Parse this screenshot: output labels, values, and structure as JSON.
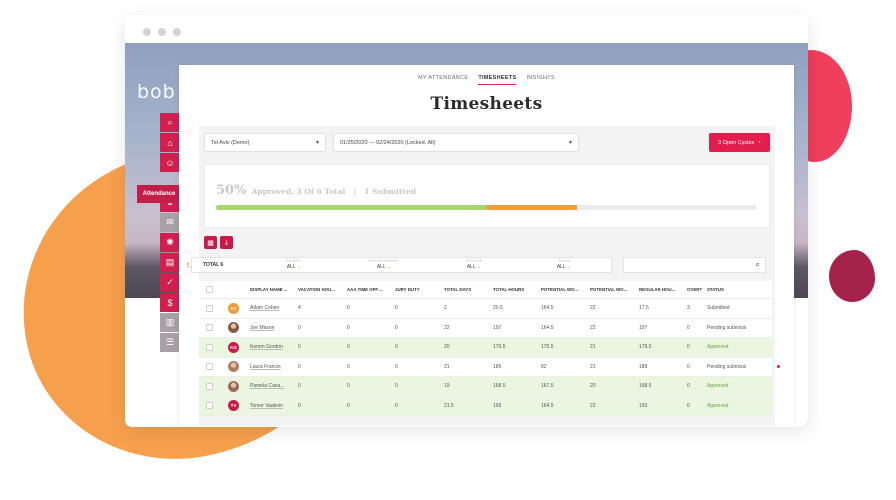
{
  "app": {
    "logo_text": "bob"
  },
  "sidebar": {
    "active_label": "Attendance",
    "items": [
      {
        "icon": "search-icon",
        "glyph": "⌕"
      },
      {
        "icon": "home-icon",
        "glyph": "⌂"
      },
      {
        "icon": "people-icon",
        "glyph": "☺"
      },
      {
        "icon": "attendance-icon",
        "glyph": "◷"
      },
      {
        "icon": "trophy-icon",
        "glyph": "♛"
      },
      {
        "icon": "chat-icon",
        "glyph": "✉"
      },
      {
        "icon": "gear-icon",
        "glyph": "✺"
      },
      {
        "icon": "documents-icon",
        "glyph": "▤"
      },
      {
        "icon": "tasks-icon",
        "glyph": "✓"
      },
      {
        "icon": "dollar-icon",
        "glyph": "$"
      },
      {
        "icon": "analytics-icon",
        "glyph": "▥"
      },
      {
        "icon": "settings-sliders-icon",
        "glyph": "☰"
      }
    ]
  },
  "tabs": [
    {
      "label": "MY ATTENDANCE",
      "active": false
    },
    {
      "label": "TIMESHEETS",
      "active": true
    },
    {
      "label": "INSIGHTS",
      "active": false
    }
  ],
  "page": {
    "title": "Timesheets"
  },
  "controls": {
    "site_select": "Tel Aviv (Demo)",
    "cycle_select": "01/25/2020 — 02/24/2020 (Locked, All)",
    "open_cycles_button": "3 Open Cycles"
  },
  "progress": {
    "percent_label": "50%",
    "approved_text": "Approved, 3 Of 6 Total",
    "separator": "|",
    "submitted_text": "1 Submitted",
    "approved_fraction": 0.5,
    "submitted_fraction": 0.1667,
    "colors": {
      "approved": "#a7d76b",
      "submitted": "#f29c35",
      "track": "#ececec"
    }
  },
  "filters": {
    "total": "TOTAL 6",
    "groups": [
      {
        "label": "TEMPO",
        "value": "ALL"
      },
      {
        "label": "DEPARTMENT",
        "value": "ALL"
      },
      {
        "label": "STATUS",
        "value": "ALL"
      },
      {
        "label": "TEAM",
        "value": "ALL"
      }
    ]
  },
  "table": {
    "headers": [
      "DISPLAY NAME ...",
      "VACATION HOU...",
      "AAA TIME OFF ...",
      "JURY DUTY",
      "TOTAL DAYS",
      "TOTAL HOURS",
      "POTENTIAL WO...",
      "POTENTIAL WO...",
      "REGULAR HOU...",
      "OVERT",
      "STATUS"
    ],
    "rows": [
      {
        "initials": "AC",
        "avatar_color": "#f29c35",
        "photo": false,
        "name": "Adam Cohen",
        "values": [
          "4",
          "0",
          "0",
          "2",
          "20.5",
          "164.5",
          "22",
          "17.5",
          "3"
        ],
        "status": "Submitted",
        "approved": false
      },
      {
        "initials": "",
        "avatar_color": "#8a5a45",
        "photo": true,
        "name": "Joe Mason",
        "values": [
          "0",
          "0",
          "0",
          "22",
          "197",
          "164.5",
          "22",
          "197",
          "0"
        ],
        "status": "Pending submissi",
        "approved": false
      },
      {
        "initials": "KG",
        "avatar_color": "#c8194b",
        "photo": false,
        "name": "Kerem Gordon",
        "values": [
          "0",
          "0",
          "0",
          "20",
          "179.5",
          "175.5",
          "21",
          "179.5",
          "0"
        ],
        "status": "Approved",
        "approved": true
      },
      {
        "initials": "",
        "avatar_color": "#b07a66",
        "photo": true,
        "name": "Laura Francis",
        "values": [
          "0",
          "0",
          "0",
          "21",
          "189",
          "82",
          "21",
          "189",
          "0"
        ],
        "status": "Pending submissi",
        "approved": false
      },
      {
        "initials": "",
        "avatar_color": "#9a6a55",
        "photo": true,
        "name": "Pamela Cana...",
        "values": [
          "0",
          "0",
          "0",
          "19",
          "168.5",
          "167.5",
          "20",
          "168.5",
          "0"
        ],
        "status": "Approved",
        "approved": true
      },
      {
        "initials": "TV",
        "avatar_color": "#c8194b",
        "photo": false,
        "name": "Tomer Vaaknin",
        "values": [
          "0",
          "0",
          "0",
          "21.5",
          "193",
          "164.5",
          "22",
          "193",
          "0"
        ],
        "status": "Approved",
        "approved": true
      }
    ]
  }
}
